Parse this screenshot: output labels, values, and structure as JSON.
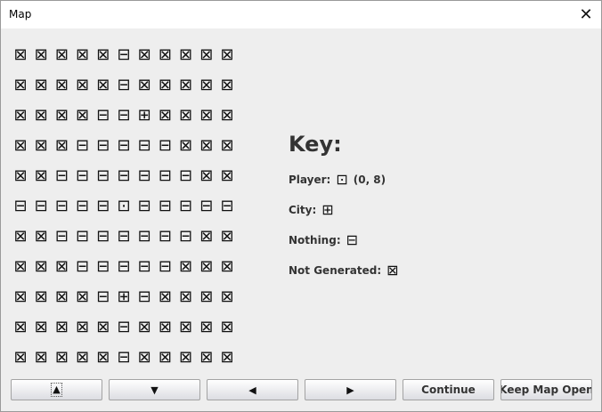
{
  "window": {
    "title": "Map",
    "close_glyph": "✕"
  },
  "glyphs": {
    "not_generated": "⊠",
    "nothing": "⊟",
    "city": "⊞",
    "player": "⊡"
  },
  "map": {
    "rows": [
      [
        "⊠",
        "⊠",
        "⊠",
        "⊠",
        "⊠",
        "⊟",
        "⊠",
        "⊠",
        "⊠",
        "⊠",
        "⊠"
      ],
      [
        "⊠",
        "⊠",
        "⊠",
        "⊠",
        "⊠",
        "⊟",
        "⊠",
        "⊠",
        "⊠",
        "⊠",
        "⊠"
      ],
      [
        "⊠",
        "⊠",
        "⊠",
        "⊠",
        "⊟",
        "⊟",
        "⊞",
        "⊠",
        "⊠",
        "⊠",
        "⊠"
      ],
      [
        "⊠",
        "⊠",
        "⊠",
        "⊟",
        "⊟",
        "⊟",
        "⊟",
        "⊟",
        "⊠",
        "⊠",
        "⊠"
      ],
      [
        "⊠",
        "⊠",
        "⊟",
        "⊟",
        "⊟",
        "⊟",
        "⊟",
        "⊟",
        "⊟",
        "⊠",
        "⊠"
      ],
      [
        "⊟",
        "⊟",
        "⊟",
        "⊟",
        "⊟",
        "⊡",
        "⊟",
        "⊟",
        "⊟",
        "⊟",
        "⊟"
      ],
      [
        "⊠",
        "⊠",
        "⊟",
        "⊟",
        "⊟",
        "⊟",
        "⊟",
        "⊟",
        "⊟",
        "⊠",
        "⊠"
      ],
      [
        "⊠",
        "⊠",
        "⊠",
        "⊟",
        "⊟",
        "⊟",
        "⊟",
        "⊟",
        "⊠",
        "⊠",
        "⊠"
      ],
      [
        "⊠",
        "⊠",
        "⊠",
        "⊠",
        "⊟",
        "⊞",
        "⊟",
        "⊠",
        "⊠",
        "⊠",
        "⊠"
      ],
      [
        "⊠",
        "⊠",
        "⊠",
        "⊠",
        "⊠",
        "⊟",
        "⊠",
        "⊠",
        "⊠",
        "⊠",
        "⊠"
      ],
      [
        "⊠",
        "⊠",
        "⊠",
        "⊠",
        "⊠",
        "⊟",
        "⊠",
        "⊠",
        "⊠",
        "⊠",
        "⊠"
      ]
    ]
  },
  "key": {
    "title": "Key:",
    "player_label": "Player:",
    "player_coords": "(0, 8)",
    "city_label": "City:",
    "nothing_label": "Nothing:",
    "not_generated_label": "Not Generated:"
  },
  "buttons": {
    "up": "▲",
    "down": "▼",
    "left": "◀",
    "right": "▶",
    "continue": "Continue",
    "keep_open": "Keep Map Open"
  }
}
